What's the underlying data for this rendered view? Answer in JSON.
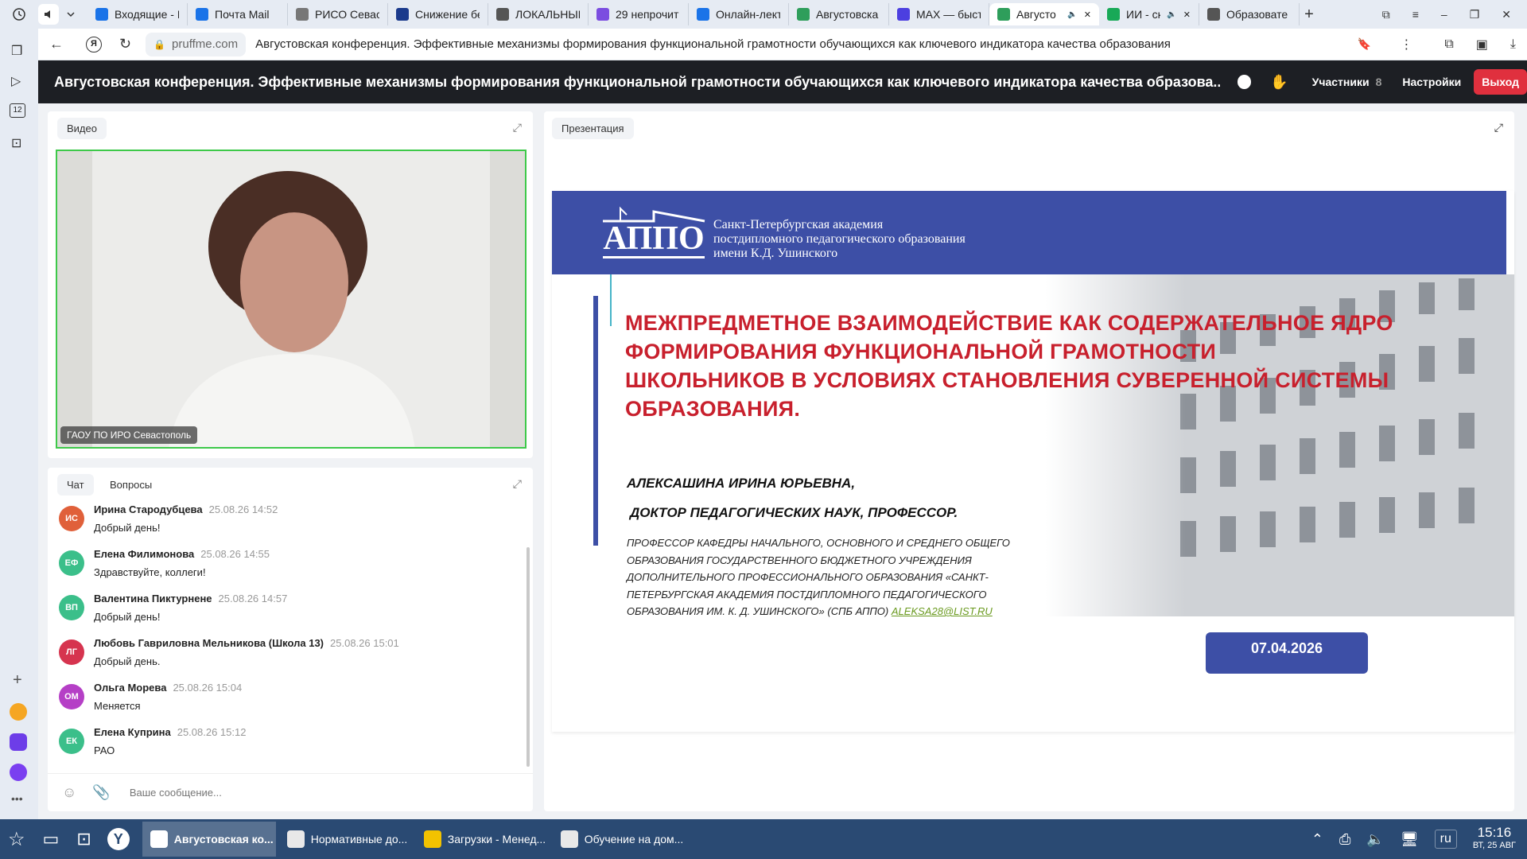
{
  "browser": {
    "tabs": [
      {
        "label": "Входящие - Г",
        "color": "#1a73e8"
      },
      {
        "label": "Почта Mail",
        "color": "#1a73e8"
      },
      {
        "label": "РИСО Севас",
        "color": "#777"
      },
      {
        "label": "Снижение бе",
        "color": "#1b3a8c"
      },
      {
        "label": "ЛОКАЛЬНЫЕ",
        "color": "#555"
      },
      {
        "label": "29 непрочит",
        "color": "#7b4de0"
      },
      {
        "label": "Онлайн-лект",
        "color": "#1a73e8"
      },
      {
        "label": "Августовска",
        "color": "#2e9e5b"
      },
      {
        "label": "MAX — быст",
        "color": "#4c3fe0"
      },
      {
        "label": "Августо",
        "color": "#2e9e5b"
      },
      {
        "label": "ИИ - ск",
        "color": "#18a957"
      },
      {
        "label": "Образовате",
        "color": "#555"
      }
    ],
    "address_domain": "pruffme.com",
    "address_title": "Августовская конференция. Эффективные механизмы формирования функциональной грамотности обучающихся как ключевого индикатора качества образования"
  },
  "app": {
    "title": "Августовская конференция. Эффективные механизмы формирования функциональной грамотности обучающихся как ключевого индикатора качества образова...",
    "participants_label": "Участники",
    "participants_count": "8",
    "settings_label": "Настройки",
    "exit_label": "Выход"
  },
  "video": {
    "tab_label": "Видео",
    "caption": "ГАОУ ПО ИРО Севастополь"
  },
  "chat": {
    "tab_chat": "Чат",
    "tab_questions": "Вопросы",
    "input_placeholder": "Ваше сообщение...",
    "messages": [
      {
        "initials": "ИС",
        "name": "Ирина Стародубцева",
        "time": "25.08.26 14:52",
        "text": "Добрый день!",
        "color": "#e0603a"
      },
      {
        "initials": "ЕФ",
        "name": "Елена Филимонова",
        "time": "25.08.26 14:55",
        "text": "Здравствуйте, коллеги!",
        "color": "#3bbf8a"
      },
      {
        "initials": "ВП",
        "name": "Валентина Пиктурнене",
        "time": "25.08.26 14:57",
        "text": "Добрый день!",
        "color": "#3bbf8a"
      },
      {
        "initials": "ЛГ",
        "name": "Любовь Гавриловна Мельникова (Школа 13)",
        "time": "25.08.26 15:01",
        "text": "Добрый день.",
        "color": "#d6344f"
      },
      {
        "initials": "ОМ",
        "name": "Ольга Морева",
        "time": "25.08.26 15:04",
        "text": "Меняется",
        "color": "#b53fc6"
      },
      {
        "initials": "ЕК",
        "name": "Елена Куприна",
        "time": "25.08.26 15:12",
        "text": "РАО",
        "color": "#3bbf8a"
      }
    ]
  },
  "presentation": {
    "tab_label": "Презентация",
    "logo_text": "АППО",
    "org_line1": "Санкт-Петербургская академия",
    "org_line2": "постдипломного педагогического образования",
    "org_line3": "имени К.Д. Ушинского",
    "title_line1": "МЕЖПРЕДМЕТНОЕ ВЗАИМОДЕЙСТВИЕ КАК СОДЕРЖАТЕЛЬНОЕ ЯДРО",
    "title_line2": "ФОРМИРОВАНИЯ ФУНКЦИОНАЛЬНОЙ ГРАМОТНОСТИ",
    "title_line3": "ШКОЛЬНИКОВ В УСЛОВИЯХ СТАНОВЛЕНИЯ СУВЕРЕННОЙ СИСТЕМЫ",
    "title_line4": "ОБРАЗОВАНИЯ.",
    "author": "АЛЕКСАШИНА ИРИНА ЮРЬЕВНА,",
    "degree": "ДОКТОР ПЕДАГОГИЧЕСКИХ НАУК, ПРОФЕССОР.",
    "position_line1": "ПРОФЕССОР КАФЕДРЫ НАЧАЛЬНОГО, ОСНОВНОГО И СРЕДНЕГО ОБЩЕГО",
    "position_line2": "ОБРАЗОВАНИЯ ГОСУДАРСТВЕННОГО БЮДЖЕТНОГО УЧРЕЖДЕНИЯ",
    "position_line3": "ДОПОЛНИТЕЛЬНОГО ПРОФЕССИОНАЛЬНОГО ОБРАЗОВАНИЯ «САНКТ-",
    "position_line4": "ПЕТЕРБУРГСКАЯ АКАДЕМИЯ ПОСТДИПЛОМНОГО ПЕДАГОГИЧЕСКОГО",
    "position_line5": "ОБРАЗОВАНИЯ ИМ. К. Д. УШИНСКОГО» (СПБ АППО)",
    "email": "ALEKSA28@LIST.RU",
    "date": "07.04.2026"
  },
  "taskbar": {
    "tasks": [
      {
        "label": "Августовская ко...",
        "active": true
      },
      {
        "label": "Нормативные до..."
      },
      {
        "label": "Загрузки - Менед..."
      },
      {
        "label": "Обучение на дом..."
      }
    ],
    "lang": "ru",
    "time": "15:16",
    "date": "ВТ, 25 АВГ"
  },
  "colors": {
    "accent_red": "#e0303e",
    "slide_blue": "#3d4fa6",
    "video_border": "#3ec94a",
    "taskbar": "#2a4a73"
  }
}
